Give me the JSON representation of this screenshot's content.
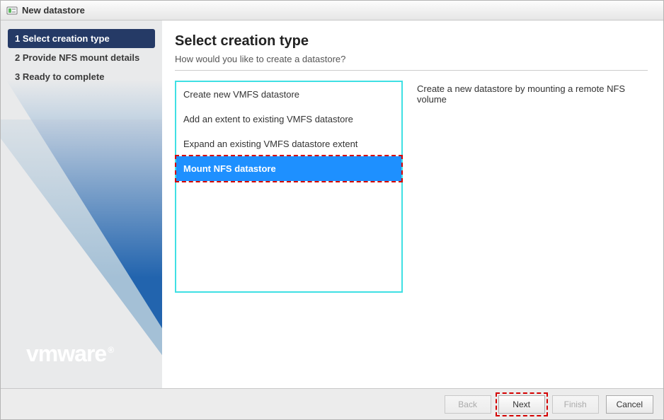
{
  "window": {
    "title": "New datastore"
  },
  "sidebar": {
    "steps": [
      {
        "label": "1 Select creation type",
        "active": true
      },
      {
        "label": "2 Provide NFS mount details",
        "active": false
      },
      {
        "label": "3 Ready to complete",
        "active": false
      }
    ],
    "logo": "vmware"
  },
  "main": {
    "heading": "Select creation type",
    "subtitle": "How would you like to create a datastore?",
    "options": [
      {
        "label": "Create new VMFS datastore",
        "selected": false
      },
      {
        "label": "Add an extent to existing VMFS datastore",
        "selected": false
      },
      {
        "label": "Expand an existing VMFS datastore extent",
        "selected": false
      },
      {
        "label": "Mount NFS datastore",
        "selected": true,
        "highlighted": true
      }
    ],
    "description": "Create a new datastore by mounting a remote NFS volume"
  },
  "footer": {
    "back": {
      "label": "Back",
      "enabled": false
    },
    "next": {
      "label": "Next",
      "enabled": true,
      "highlighted": true
    },
    "finish": {
      "label": "Finish",
      "enabled": false
    },
    "cancel": {
      "label": "Cancel",
      "enabled": true
    }
  }
}
